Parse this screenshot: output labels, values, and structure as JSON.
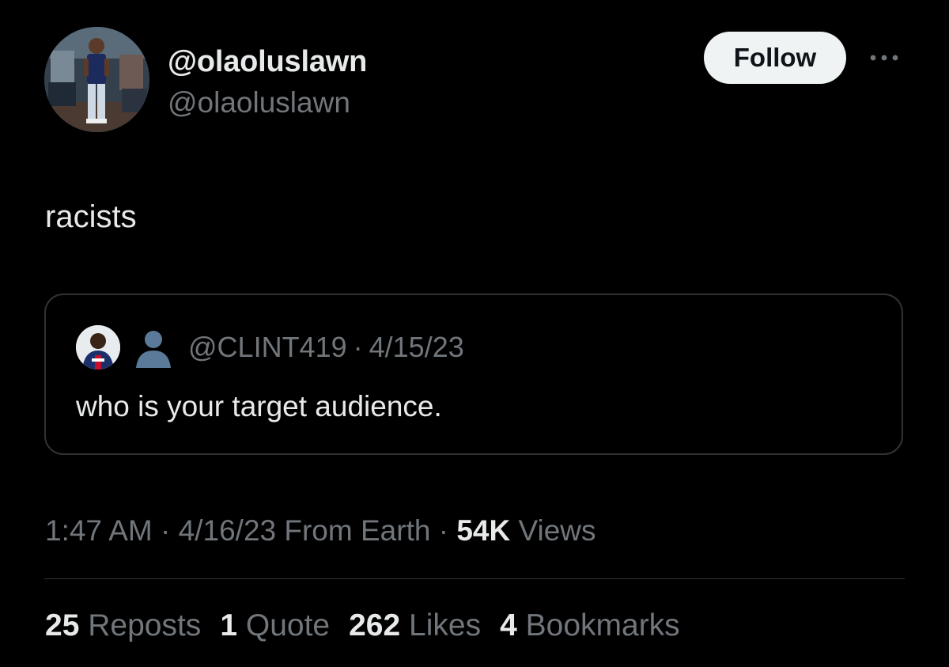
{
  "author": {
    "display_name": "@olaoluslawn",
    "handle": "@olaoluslawn",
    "avatar_icon": "profile-photo"
  },
  "actions": {
    "follow_label": "Follow",
    "more_icon": "more-horizontal-icon"
  },
  "tweet": {
    "text": "racists"
  },
  "quoted": {
    "avatar_icon": "profile-photo",
    "emoji_icon": "bust-in-silhouette-icon",
    "handle": "@CLINT419",
    "separator": "·",
    "date": "4/15/23",
    "text": "who is your target audience."
  },
  "meta": {
    "time": "1:47 AM",
    "sep1": "·",
    "date_source": "4/16/23 From Earth",
    "sep2": "·",
    "views_count": "54K",
    "views_label": "Views"
  },
  "stats": [
    {
      "count": "25",
      "label": "Reposts"
    },
    {
      "count": "1",
      "label": "Quote"
    },
    {
      "count": "262",
      "label": "Likes"
    },
    {
      "count": "4",
      "label": "Bookmarks"
    }
  ],
  "colors": {
    "background": "#000000",
    "primary_text": "#e7e9ea",
    "secondary_text": "#71767b",
    "border": "#2f3336",
    "follow_bg": "#eff3f4"
  }
}
